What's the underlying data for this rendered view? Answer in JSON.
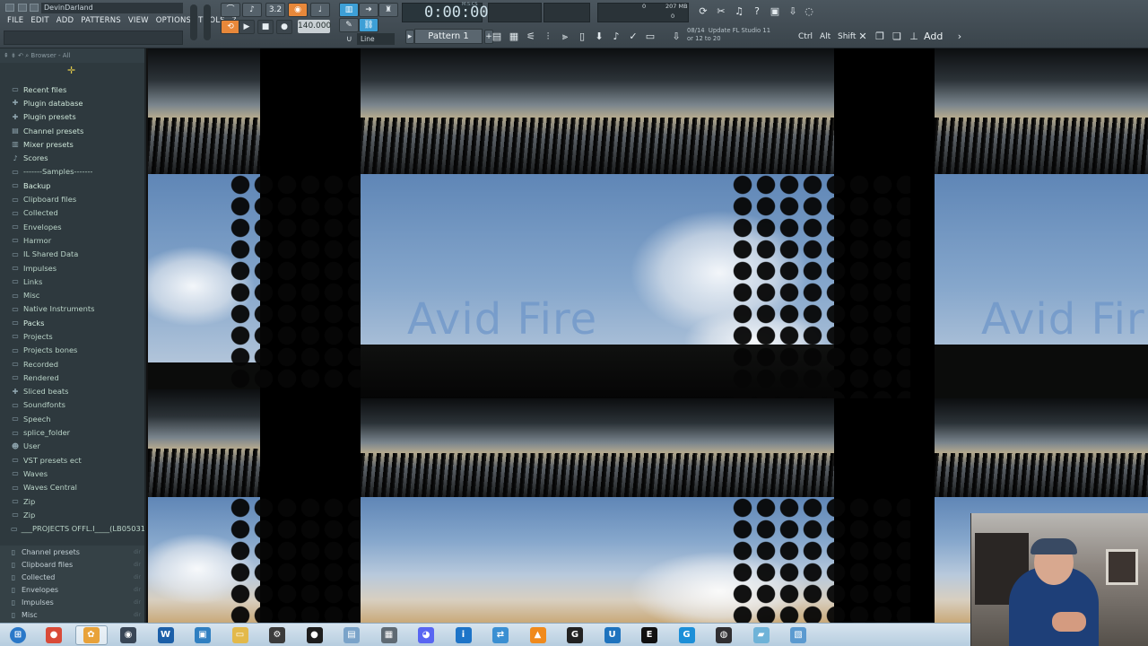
{
  "window": {
    "title": "DevinDarland"
  },
  "menu": [
    "FILE",
    "EDIT",
    "ADD",
    "PATTERNS",
    "VIEW",
    "OPTIONS",
    "TOOLS",
    "?"
  ],
  "transport": {
    "time": "0:00:00",
    "time_unit": "M:S:CS",
    "tempo": "140.000",
    "snap": "Line",
    "pattern": "Pattern 1",
    "cpu": "0",
    "memory": "207 MB",
    "polyphony": "0",
    "seg_32": "3.2"
  },
  "news": {
    "date": "08/14",
    "text": "Update FL Studio 11",
    "text2": "or 12 to 20"
  },
  "keys": {
    "ctrl": "Ctrl",
    "alt": "Alt",
    "shift": "Shift",
    "add": "Add"
  },
  "browser": {
    "header": "Browser - All",
    "items": [
      {
        "label": "Recent files",
        "icon": "folder-icon",
        "kind": "top"
      },
      {
        "label": "Plugin database",
        "icon": "plug-icon",
        "kind": "top"
      },
      {
        "label": "Plugin presets",
        "icon": "plug-icon",
        "kind": "top"
      },
      {
        "label": "Channel presets",
        "icon": "channel-icon",
        "kind": "top"
      },
      {
        "label": "Mixer presets",
        "icon": "mixer-icon",
        "kind": "top"
      },
      {
        "label": "Scores",
        "icon": "note-icon",
        "kind": "top"
      },
      {
        "label": "-------Samples-------",
        "icon": "folder-icon",
        "kind": ""
      },
      {
        "label": "Backup",
        "icon": "folder-icon",
        "kind": "hl"
      },
      {
        "label": "Clipboard files",
        "icon": "folder-icon",
        "kind": ""
      },
      {
        "label": "Collected",
        "icon": "folder-icon",
        "kind": ""
      },
      {
        "label": "Envelopes",
        "icon": "folder-icon",
        "kind": ""
      },
      {
        "label": "Harmor",
        "icon": "folder-icon",
        "kind": ""
      },
      {
        "label": "IL Shared Data",
        "icon": "folder-icon",
        "kind": ""
      },
      {
        "label": "Impulses",
        "icon": "folder-icon",
        "kind": ""
      },
      {
        "label": "Links",
        "icon": "folder-icon",
        "kind": ""
      },
      {
        "label": "Misc",
        "icon": "folder-icon",
        "kind": ""
      },
      {
        "label": "Native Instruments",
        "icon": "folder-icon",
        "kind": ""
      },
      {
        "label": "Packs",
        "icon": "folder-icon",
        "kind": "hl"
      },
      {
        "label": "Projects",
        "icon": "folder-icon",
        "kind": ""
      },
      {
        "label": "Projects bones",
        "icon": "folder-icon",
        "kind": ""
      },
      {
        "label": "Recorded",
        "icon": "folder-icon",
        "kind": ""
      },
      {
        "label": "Rendered",
        "icon": "folder-icon",
        "kind": ""
      },
      {
        "label": "Sliced beats",
        "icon": "plus-icon",
        "kind": ""
      },
      {
        "label": "Soundfonts",
        "icon": "folder-icon",
        "kind": ""
      },
      {
        "label": "Speech",
        "icon": "folder-icon",
        "kind": ""
      },
      {
        "label": "splice_folder",
        "icon": "folder-icon",
        "kind": ""
      },
      {
        "label": "User",
        "icon": "user-icon",
        "kind": ""
      },
      {
        "label": "VST presets ect",
        "icon": "folder-icon",
        "kind": ""
      },
      {
        "label": "Waves",
        "icon": "folder-icon",
        "kind": ""
      },
      {
        "label": "Waves Central",
        "icon": "folder-icon",
        "kind": ""
      },
      {
        "label": "Zip",
        "icon": "folder-icon",
        "kind": ""
      },
      {
        "label": "Zip",
        "icon": "folder-icon",
        "kind": ""
      },
      {
        "label": "___PROJECTS OFFL.I____(LB050317)",
        "icon": "folder-icon",
        "kind": ""
      }
    ],
    "lower_items": [
      {
        "label": "Channel presets",
        "meta": "dir"
      },
      {
        "label": "Clipboard files",
        "meta": "dir"
      },
      {
        "label": "Collected",
        "meta": "dir"
      },
      {
        "label": "Envelopes",
        "meta": "dir"
      },
      {
        "label": "Impulses",
        "meta": "dir"
      },
      {
        "label": "Misc",
        "meta": "dir"
      }
    ]
  },
  "video": {
    "watermark": "Avid Fire",
    "watermark_partial": "Avid Fir"
  },
  "taskbar": {
    "apps": [
      {
        "name": "windows-start-icon",
        "glyph": "⊞",
        "color": "#2a78c8"
      },
      {
        "name": "chrome-icon",
        "glyph": "●",
        "color": "#d94a38"
      },
      {
        "name": "fl-studio-icon",
        "glyph": "✿",
        "color": "#e8a23a"
      },
      {
        "name": "davinci-resolve-icon",
        "glyph": "◉",
        "color": "#394656"
      },
      {
        "name": "waves-icon",
        "glyph": "W",
        "color": "#1c5fa8"
      },
      {
        "name": "screen-capture-icon",
        "glyph": "▣",
        "color": "#2f7fc1"
      },
      {
        "name": "file-explorer-icon",
        "glyph": "▭",
        "color": "#e3b94a"
      },
      {
        "name": "gpu-tweak-icon",
        "glyph": "⚙",
        "color": "#3b3b3b"
      },
      {
        "name": "obs-record-icon",
        "glyph": "●",
        "color": "#1d1d1d"
      },
      {
        "name": "notepad-icon",
        "glyph": "▤",
        "color": "#7aa3c9"
      },
      {
        "name": "calculator-icon",
        "glyph": "▦",
        "color": "#5f6a73"
      },
      {
        "name": "discord-icon",
        "glyph": "◕",
        "color": "#5865f2"
      },
      {
        "name": "info-icon",
        "glyph": "i",
        "color": "#1d74c8"
      },
      {
        "name": "network-icon",
        "glyph": "⇄",
        "color": "#3a8fd2"
      },
      {
        "name": "vlc-icon",
        "glyph": "▲",
        "color": "#f08a1c"
      },
      {
        "name": "logitech-g-icon",
        "glyph": "G",
        "color": "#222"
      },
      {
        "name": "uplay-icon",
        "glyph": "U",
        "color": "#1e73be"
      },
      {
        "name": "epic-games-icon",
        "glyph": "E",
        "color": "#111"
      },
      {
        "name": "g-hub-icon",
        "glyph": "G",
        "color": "#1c8fd8"
      },
      {
        "name": "obs-icon",
        "glyph": "◍",
        "color": "#302e31"
      },
      {
        "name": "folder-drive-icon",
        "glyph": "▰",
        "color": "#6fb3d8"
      },
      {
        "name": "image-viewer-icon",
        "glyph": "▧",
        "color": "#5b9ad0"
      }
    ]
  }
}
